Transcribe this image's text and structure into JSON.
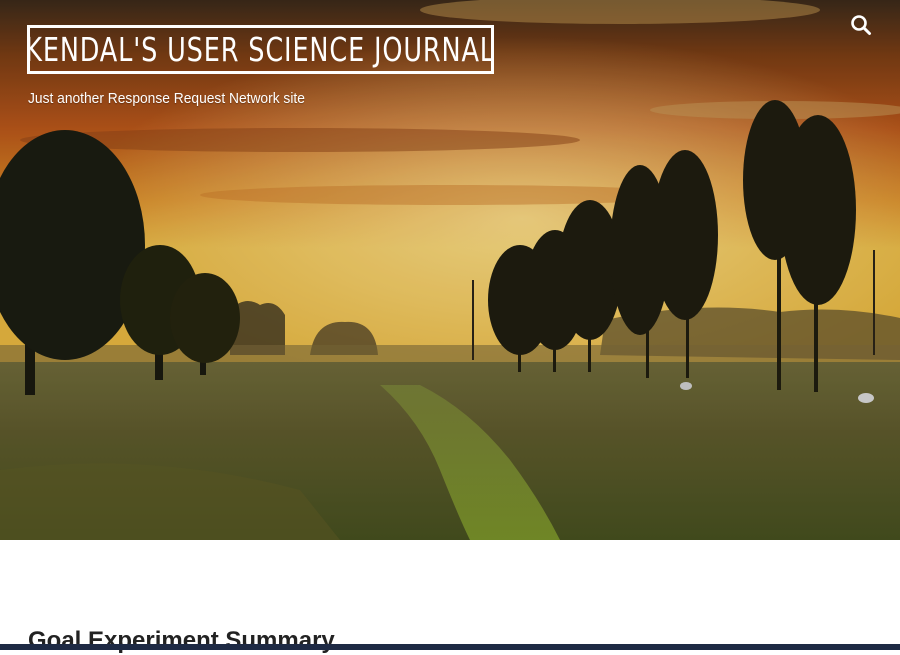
{
  "header": {
    "site_title": "KENDAL'S USER SCIENCE JOURNAL",
    "tagline": "Just another Response Request Network site",
    "search_icon": "search-icon"
  },
  "hero": {
    "image": "sunset-field-with-trees"
  },
  "main": {
    "post_title": "Goal Experiment Summary"
  }
}
